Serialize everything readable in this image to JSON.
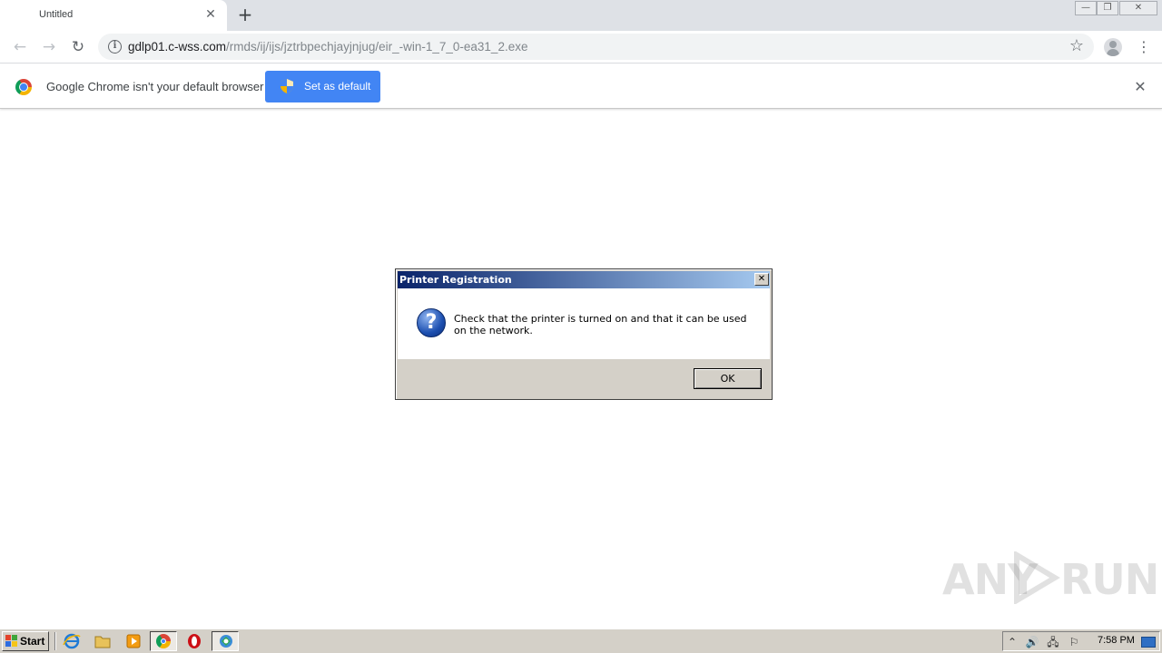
{
  "browser": {
    "tab_title": "Untitled",
    "url_host": "gdlp01.c-wss.com",
    "url_path": "/rmds/ij/ijs/jztrbpechjayjnjug/eir_-win-1_7_0-ea31_2.exe"
  },
  "infobar": {
    "message": "Google Chrome isn't your default browser",
    "set_default_label": "Set as default"
  },
  "dialog": {
    "title": "Printer Registration",
    "message": "Check that the printer is turned on and that it can be used on the network.",
    "ok_label": "OK"
  },
  "watermark": {
    "left": "ANY",
    "right": "RUN"
  },
  "taskbar": {
    "start_label": "Start",
    "clock": "7:58 PM"
  },
  "colors": {
    "chrome_blue": "#4285f4",
    "title_gradient_start": "#0a246a",
    "title_gradient_end": "#a6caf0",
    "taskbar_bg": "#d4d0c8"
  },
  "icons": [
    "tab-close-icon",
    "new-tab-icon",
    "back-arrow-icon",
    "forward-arrow-icon",
    "reload-icon",
    "info-icon",
    "star-icon",
    "profile-icon",
    "menu-icon",
    "chrome-logo-icon",
    "shield-icon",
    "close-icon",
    "question-icon",
    "start-logo-icon",
    "ie-icon",
    "folder-icon",
    "media-player-icon",
    "chrome-icon",
    "opera-icon",
    "printer-app-icon"
  ]
}
